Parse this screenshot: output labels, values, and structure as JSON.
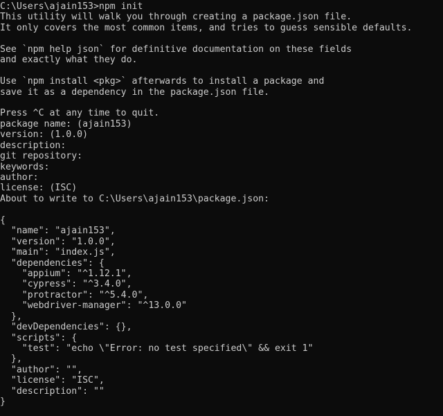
{
  "terminal": {
    "lines": [
      "C:\\Users\\ajain153>npm init",
      "This utility will walk you through creating a package.json file.",
      "It only covers the most common items, and tries to guess sensible defaults.",
      "",
      "See `npm help json` for definitive documentation on these fields",
      "and exactly what they do.",
      "",
      "Use `npm install <pkg>` afterwards to install a package and",
      "save it as a dependency in the package.json file.",
      "",
      "Press ^C at any time to quit.",
      "package name: (ajain153)",
      "version: (1.0.0)",
      "description:",
      "git repository:",
      "keywords:",
      "author:",
      "license: (ISC)",
      "About to write to C:\\Users\\ajain153\\package.json:",
      "",
      "{",
      "  \"name\": \"ajain153\",",
      "  \"version\": \"1.0.0\",",
      "  \"main\": \"index.js\",",
      "  \"dependencies\": {",
      "    \"appium\": \"^1.12.1\",",
      "    \"cypress\": \"^3.4.0\",",
      "    \"protractor\": \"^5.4.0\",",
      "    \"webdriver-manager\": \"^13.0.0\"",
      "  },",
      "  \"devDependencies\": {},",
      "  \"scripts\": {",
      "    \"test\": \"echo \\\"Error: no test specified\\\" && exit 1\"",
      "  },",
      "  \"author\": \"\",",
      "  \"license\": \"ISC\",",
      "  \"description\": \"\"",
      "}"
    ]
  }
}
